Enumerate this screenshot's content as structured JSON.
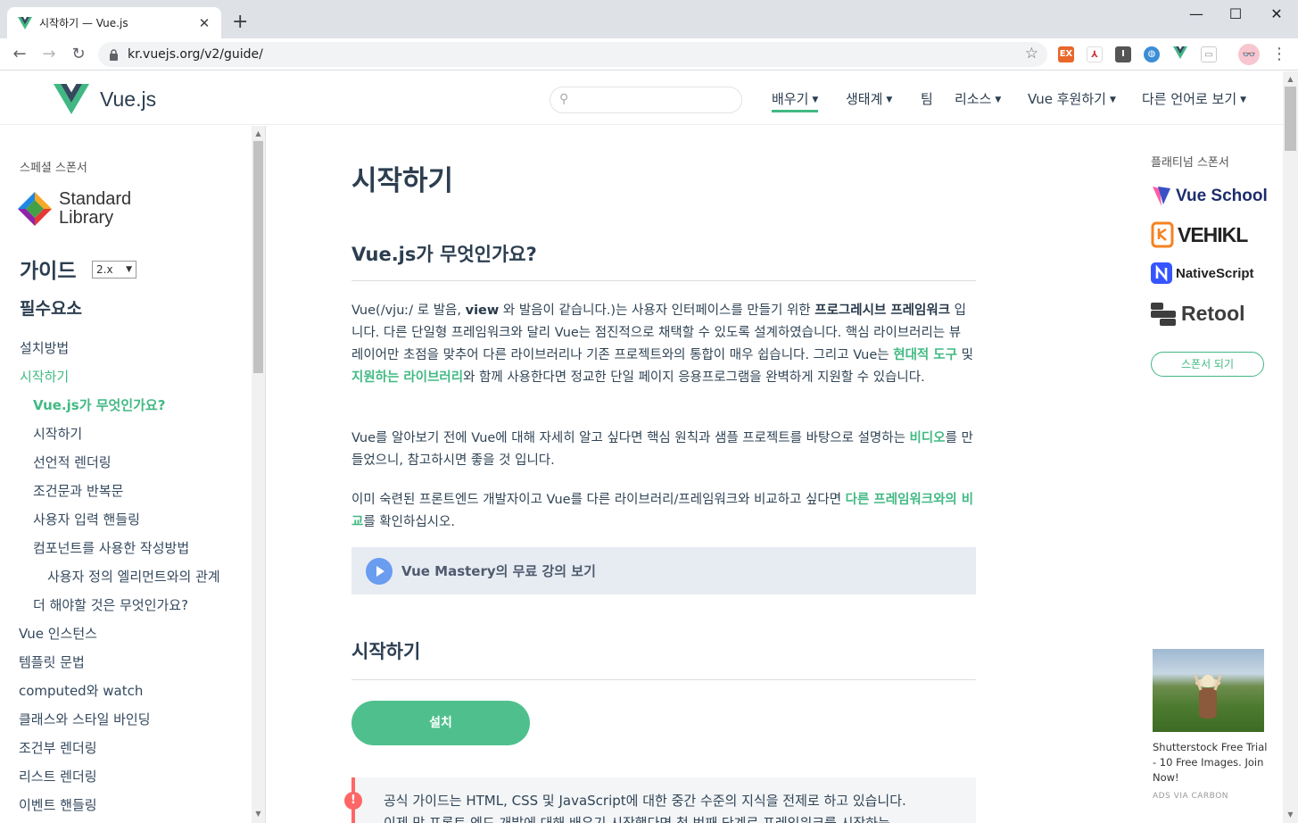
{
  "browser": {
    "tab_title": "시작하기 — Vue.js",
    "tab_close": "✕",
    "new_tab": "+",
    "url": "kr.vuejs.org/v2/guide/",
    "window": {
      "minimize": "—",
      "maximize": "☐",
      "close": "✕"
    }
  },
  "header": {
    "logo_text": "Vue.js",
    "nav": [
      {
        "label": "배우기"
      },
      {
        "label": "생태계"
      },
      {
        "label": "팀"
      },
      {
        "label": "리소스"
      },
      {
        "label": "Vue 후원하기"
      },
      {
        "label": "다른 언어로 보기"
      }
    ]
  },
  "sidebar": {
    "special_sponsor": "스페셜 스폰서",
    "sponsor_name_1": "Standard",
    "sponsor_name_2": "Library",
    "guide": "가이드",
    "version": "2.x",
    "essentials": "필수요소",
    "items": [
      {
        "label": "설치방법"
      },
      {
        "label": "시작하기"
      },
      {
        "label": "Vue.js가 무엇인가요?"
      },
      {
        "label": "시작하기"
      },
      {
        "label": "선언적 렌더링"
      },
      {
        "label": "조건문과 반복문"
      },
      {
        "label": "사용자 입력 핸들링"
      },
      {
        "label": "컴포넌트를 사용한 작성방법"
      },
      {
        "label": "사용자 정의 엘리먼트와의 관계"
      },
      {
        "label": "더 해야할 것은 무엇인가요?"
      },
      {
        "label": "Vue 인스턴스"
      },
      {
        "label": "템플릿 문법"
      },
      {
        "label": "computed와 watch"
      },
      {
        "label": "클래스와 스타일 바인딩"
      },
      {
        "label": "조건부 렌더링"
      },
      {
        "label": "리스트 렌더링"
      },
      {
        "label": "이벤트 핸들링"
      }
    ]
  },
  "main": {
    "title": "시작하기",
    "section1": "Vue.js가 무엇인가요?",
    "p1": {
      "a": "Vue(/vjuː/ 로 발음, ",
      "b": "view",
      "c": " 와 발음이 같습니다.)는 사용자 인터페이스를 만들기 위한 ",
      "d": "프로그레시브 프레임워크",
      "e": " 입니다. 다른 단일형 프레임워크와 달리 Vue는 점진적으로 채택할 수 있도록 설계하였습니다. 핵심 라이브러리는 뷰 레이어만 초점을 맞추어 다른 라이브러리나 기존 프로젝트와의 통합이 매우 쉽습니다. 그리고 Vue는 ",
      "f": "현대적 도구",
      "g": " 및 ",
      "h": "지원하는 라이브러리",
      "i": "와 함께 사용한다면 정교한 단일 페이지 응용프로그램을 완벽하게 지원할 수 있습니다."
    },
    "p2": {
      "a": "Vue를 알아보기 전에 Vue에 대해 자세히 알고 싶다면 핵심 원칙과 샘플 프로젝트를 바탕으로 설명하는 ",
      "b": "비디오",
      "c": "를 만들었으니, 참고하시면 좋을 것 입니다."
    },
    "p3": {
      "a": "이미 숙련된 프론트엔드 개발자이고 Vue를 다른 라이브러리/프레임워크와 비교하고 싶다면 ",
      "b": "다른 프레임워크와의 비교",
      "c": "를 확인하십시오."
    },
    "mastery": "Vue Mastery의 무료 강의 보기",
    "section2": "시작하기",
    "install": "설치",
    "warning_line1": "공식 가이드는 HTML, CSS 및 JavaScript에 대한 중간 수준의 지식을 전제로 하고 있습니다.",
    "warning_line2": "이제 막 프론트 엔드 개발에 대해 배우기 시작했다면 첫 번째 단계로 프레임워크를 시작하는"
  },
  "sponsors": {
    "platinum": "플래티넘 스폰서",
    "list": [
      "Vue School",
      "VEHIKL",
      "NativeScript",
      "Retool"
    ],
    "become": "스폰서 되기",
    "carbon_text": "Shutterstock Free Trial - 10 Free Images. Join Now!",
    "carbon_ads": "ADS VIA CARBON"
  },
  "colors": {
    "accent": "#42b983",
    "text": "#2c3e50"
  }
}
